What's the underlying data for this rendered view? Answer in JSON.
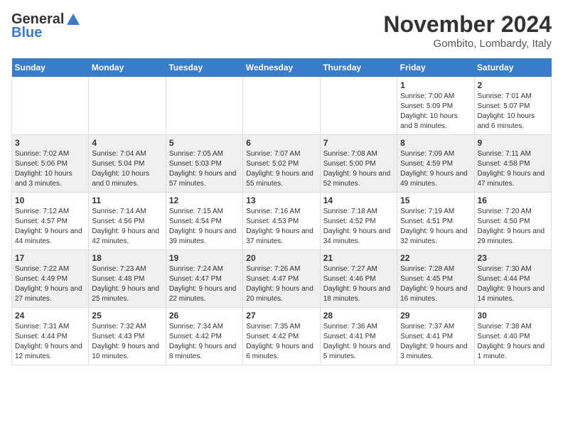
{
  "header": {
    "logo_general": "General",
    "logo_blue": "Blue",
    "month_title": "November 2024",
    "location": "Gombito, Lombardy, Italy"
  },
  "weekdays": [
    "Sunday",
    "Monday",
    "Tuesday",
    "Wednesday",
    "Thursday",
    "Friday",
    "Saturday"
  ],
  "weeks": [
    [
      {
        "day": "",
        "info": ""
      },
      {
        "day": "",
        "info": ""
      },
      {
        "day": "",
        "info": ""
      },
      {
        "day": "",
        "info": ""
      },
      {
        "day": "",
        "info": ""
      },
      {
        "day": "1",
        "info": "Sunrise: 7:00 AM\nSunset: 5:09 PM\nDaylight: 10 hours and 8 minutes."
      },
      {
        "day": "2",
        "info": "Sunrise: 7:01 AM\nSunset: 5:07 PM\nDaylight: 10 hours and 6 minutes."
      }
    ],
    [
      {
        "day": "3",
        "info": "Sunrise: 7:02 AM\nSunset: 5:06 PM\nDaylight: 10 hours and 3 minutes."
      },
      {
        "day": "4",
        "info": "Sunrise: 7:04 AM\nSunset: 5:04 PM\nDaylight: 10 hours and 0 minutes."
      },
      {
        "day": "5",
        "info": "Sunrise: 7:05 AM\nSunset: 5:03 PM\nDaylight: 9 hours and 57 minutes."
      },
      {
        "day": "6",
        "info": "Sunrise: 7:07 AM\nSunset: 5:02 PM\nDaylight: 9 hours and 55 minutes."
      },
      {
        "day": "7",
        "info": "Sunrise: 7:08 AM\nSunset: 5:00 PM\nDaylight: 9 hours and 52 minutes."
      },
      {
        "day": "8",
        "info": "Sunrise: 7:09 AM\nSunset: 4:59 PM\nDaylight: 9 hours and 49 minutes."
      },
      {
        "day": "9",
        "info": "Sunrise: 7:11 AM\nSunset: 4:58 PM\nDaylight: 9 hours and 47 minutes."
      }
    ],
    [
      {
        "day": "10",
        "info": "Sunrise: 7:12 AM\nSunset: 4:57 PM\nDaylight: 9 hours and 44 minutes."
      },
      {
        "day": "11",
        "info": "Sunrise: 7:14 AM\nSunset: 4:56 PM\nDaylight: 9 hours and 42 minutes."
      },
      {
        "day": "12",
        "info": "Sunrise: 7:15 AM\nSunset: 4:54 PM\nDaylight: 9 hours and 39 minutes."
      },
      {
        "day": "13",
        "info": "Sunrise: 7:16 AM\nSunset: 4:53 PM\nDaylight: 9 hours and 37 minutes."
      },
      {
        "day": "14",
        "info": "Sunrise: 7:18 AM\nSunset: 4:52 PM\nDaylight: 9 hours and 34 minutes."
      },
      {
        "day": "15",
        "info": "Sunrise: 7:19 AM\nSunset: 4:51 PM\nDaylight: 9 hours and 32 minutes."
      },
      {
        "day": "16",
        "info": "Sunrise: 7:20 AM\nSunset: 4:50 PM\nDaylight: 9 hours and 29 minutes."
      }
    ],
    [
      {
        "day": "17",
        "info": "Sunrise: 7:22 AM\nSunset: 4:49 PM\nDaylight: 9 hours and 27 minutes."
      },
      {
        "day": "18",
        "info": "Sunrise: 7:23 AM\nSunset: 4:48 PM\nDaylight: 9 hours and 25 minutes."
      },
      {
        "day": "19",
        "info": "Sunrise: 7:24 AM\nSunset: 4:47 PM\nDaylight: 9 hours and 22 minutes."
      },
      {
        "day": "20",
        "info": "Sunrise: 7:26 AM\nSunset: 4:47 PM\nDaylight: 9 hours and 20 minutes."
      },
      {
        "day": "21",
        "info": "Sunrise: 7:27 AM\nSunset: 4:46 PM\nDaylight: 9 hours and 18 minutes."
      },
      {
        "day": "22",
        "info": "Sunrise: 7:28 AM\nSunset: 4:45 PM\nDaylight: 9 hours and 16 minutes."
      },
      {
        "day": "23",
        "info": "Sunrise: 7:30 AM\nSunset: 4:44 PM\nDaylight: 9 hours and 14 minutes."
      }
    ],
    [
      {
        "day": "24",
        "info": "Sunrise: 7:31 AM\nSunset: 4:44 PM\nDaylight: 9 hours and 12 minutes."
      },
      {
        "day": "25",
        "info": "Sunrise: 7:32 AM\nSunset: 4:43 PM\nDaylight: 9 hours and 10 minutes."
      },
      {
        "day": "26",
        "info": "Sunrise: 7:34 AM\nSunset: 4:42 PM\nDaylight: 9 hours and 8 minutes."
      },
      {
        "day": "27",
        "info": "Sunrise: 7:35 AM\nSunset: 4:42 PM\nDaylight: 9 hours and 6 minutes."
      },
      {
        "day": "28",
        "info": "Sunrise: 7:36 AM\nSunset: 4:41 PM\nDaylight: 9 hours and 5 minutes."
      },
      {
        "day": "29",
        "info": "Sunrise: 7:37 AM\nSunset: 4:41 PM\nDaylight: 9 hours and 3 minutes."
      },
      {
        "day": "30",
        "info": "Sunrise: 7:38 AM\nSunset: 4:40 PM\nDaylight: 9 hours and 1 minute."
      }
    ]
  ]
}
